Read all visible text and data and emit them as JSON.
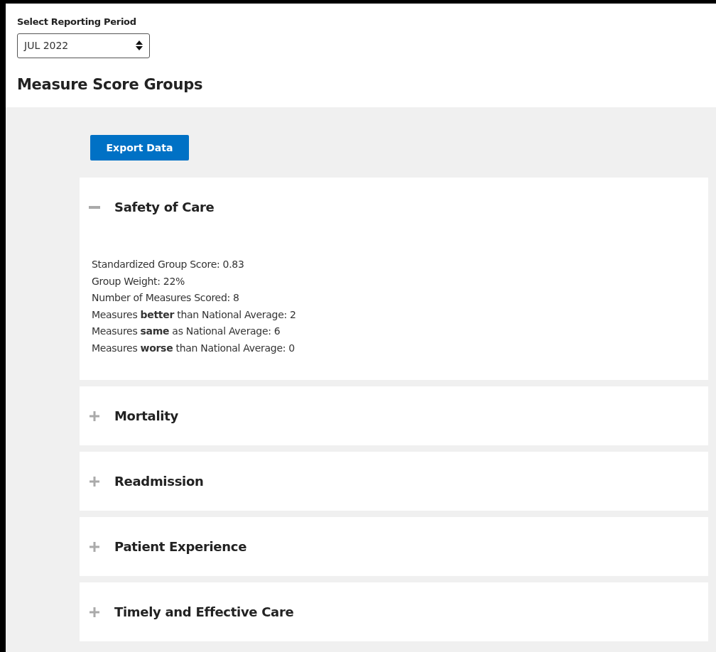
{
  "period_select": {
    "label": "Select Reporting Period",
    "value": "JUL 2022"
  },
  "heading": "Measure Score Groups",
  "export_button": "Export Data",
  "groups": [
    {
      "title": "Safety of Care",
      "expanded": true,
      "details": [
        "Standardized Group Score: 0.83",
        "Group Weight: 22%",
        "Number of Measures Scored: 8",
        "Measures **better** than National Average: 2",
        "Measures **same** as National Average: 6",
        "Measures **worse** than National Average: 0"
      ]
    },
    {
      "title": "Mortality",
      "expanded": false
    },
    {
      "title": "Readmission",
      "expanded": false
    },
    {
      "title": "Patient Experience",
      "expanded": false
    },
    {
      "title": "Timely and Effective Care",
      "expanded": false
    }
  ]
}
